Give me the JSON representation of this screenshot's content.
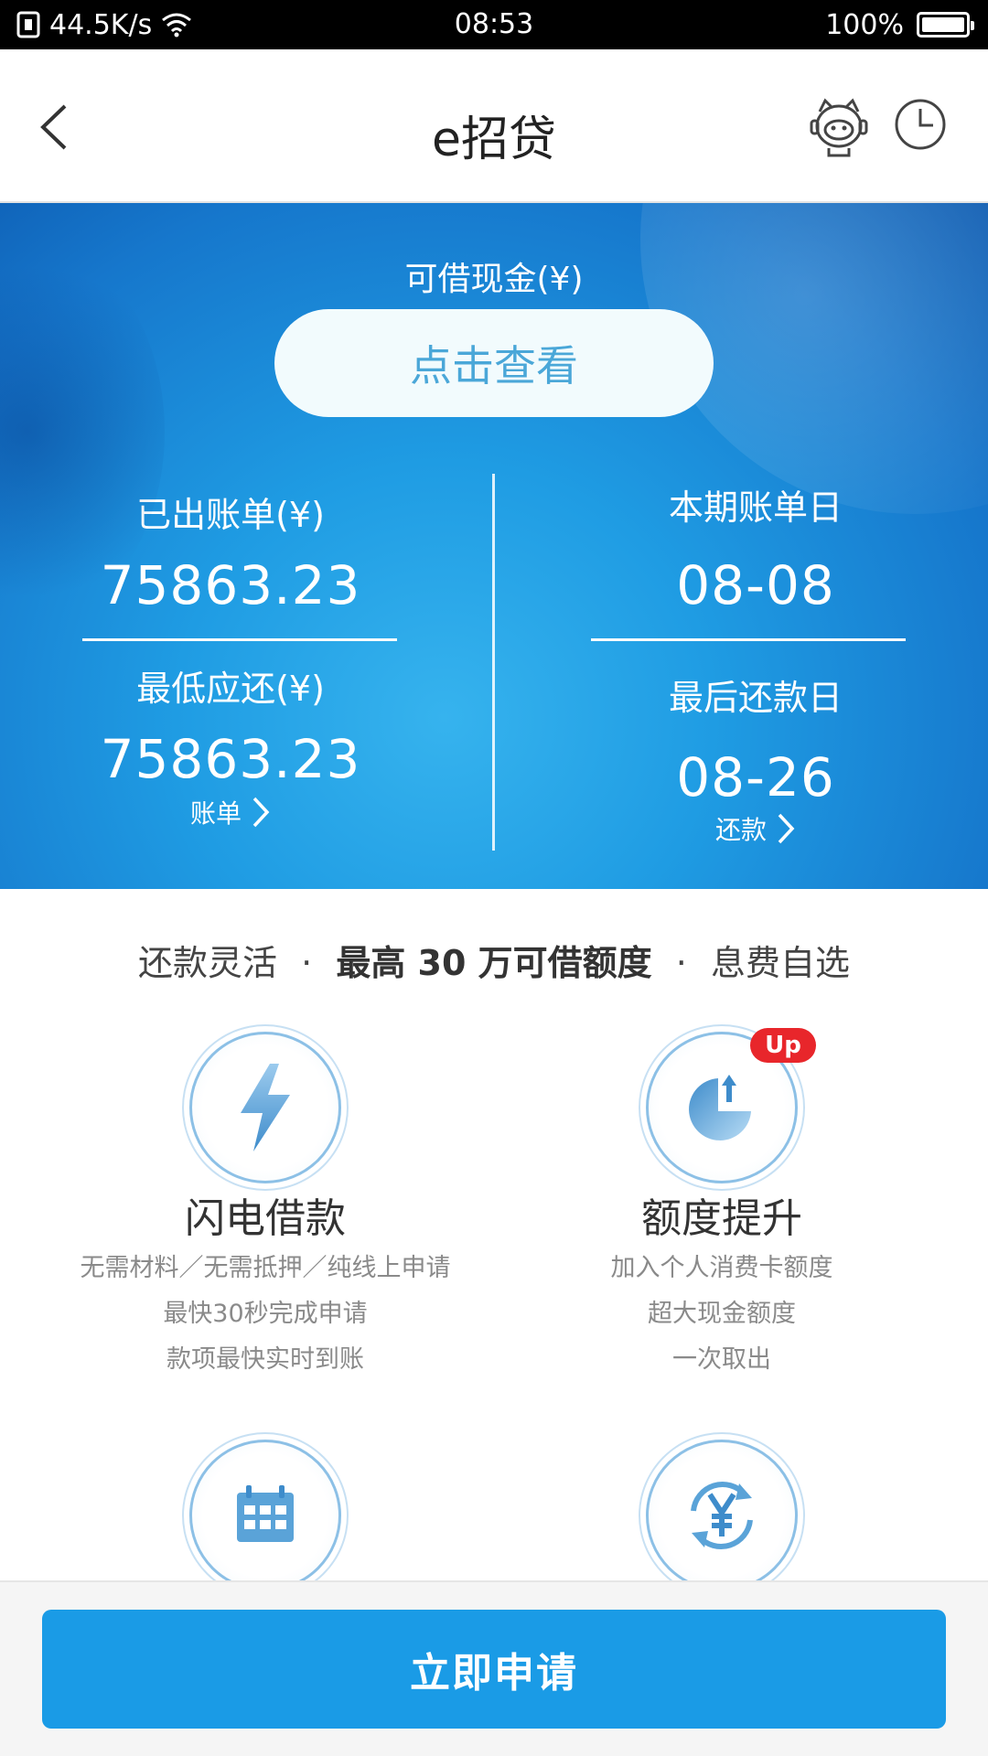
{
  "status_bar": {
    "network_speed": "44.5K/s",
    "time": "08:53",
    "battery_percent": "100%"
  },
  "header": {
    "title": "e招贷"
  },
  "banner": {
    "cash_label": "可借现金(¥)",
    "view_button": "点击查看",
    "billed_label": "已出账单(¥)",
    "billed_amount": "75863.23",
    "min_due_label": "最低应还(¥)",
    "min_due_amount": "75863.23",
    "bill_link": "账单",
    "statement_date_label": "本期账单日",
    "statement_date": "08-08",
    "due_date_label": "最后还款日",
    "due_date": "08-26",
    "repay_link": "还款"
  },
  "features": {
    "tagline_part1": "还款灵活",
    "tagline_sep1": "·",
    "tagline_part2": "最高 30 万可借额度",
    "tagline_sep2": "·",
    "tagline_part3": "息费自选",
    "items": [
      {
        "title": "闪电借款",
        "desc": [
          "无需材料／无需抵押／纯线上申请",
          "最快30秒完成申请",
          "款项最快实时到账"
        ],
        "icon": "lightning-icon"
      },
      {
        "title": "额度提升",
        "badge": "Up",
        "desc": [
          "加入个人消费卡额度",
          "超大现金额度",
          "一次取出"
        ],
        "icon": "pie-chart-up-icon"
      },
      {
        "icon": "calendar-icon"
      },
      {
        "icon": "yuan-cycle-icon"
      }
    ]
  },
  "footer": {
    "apply_button": "立即申请"
  },
  "colors": {
    "primary_blue": "#1a9be6",
    "badge_red": "#e8262b",
    "icon_blue": "#5aa3d8"
  }
}
